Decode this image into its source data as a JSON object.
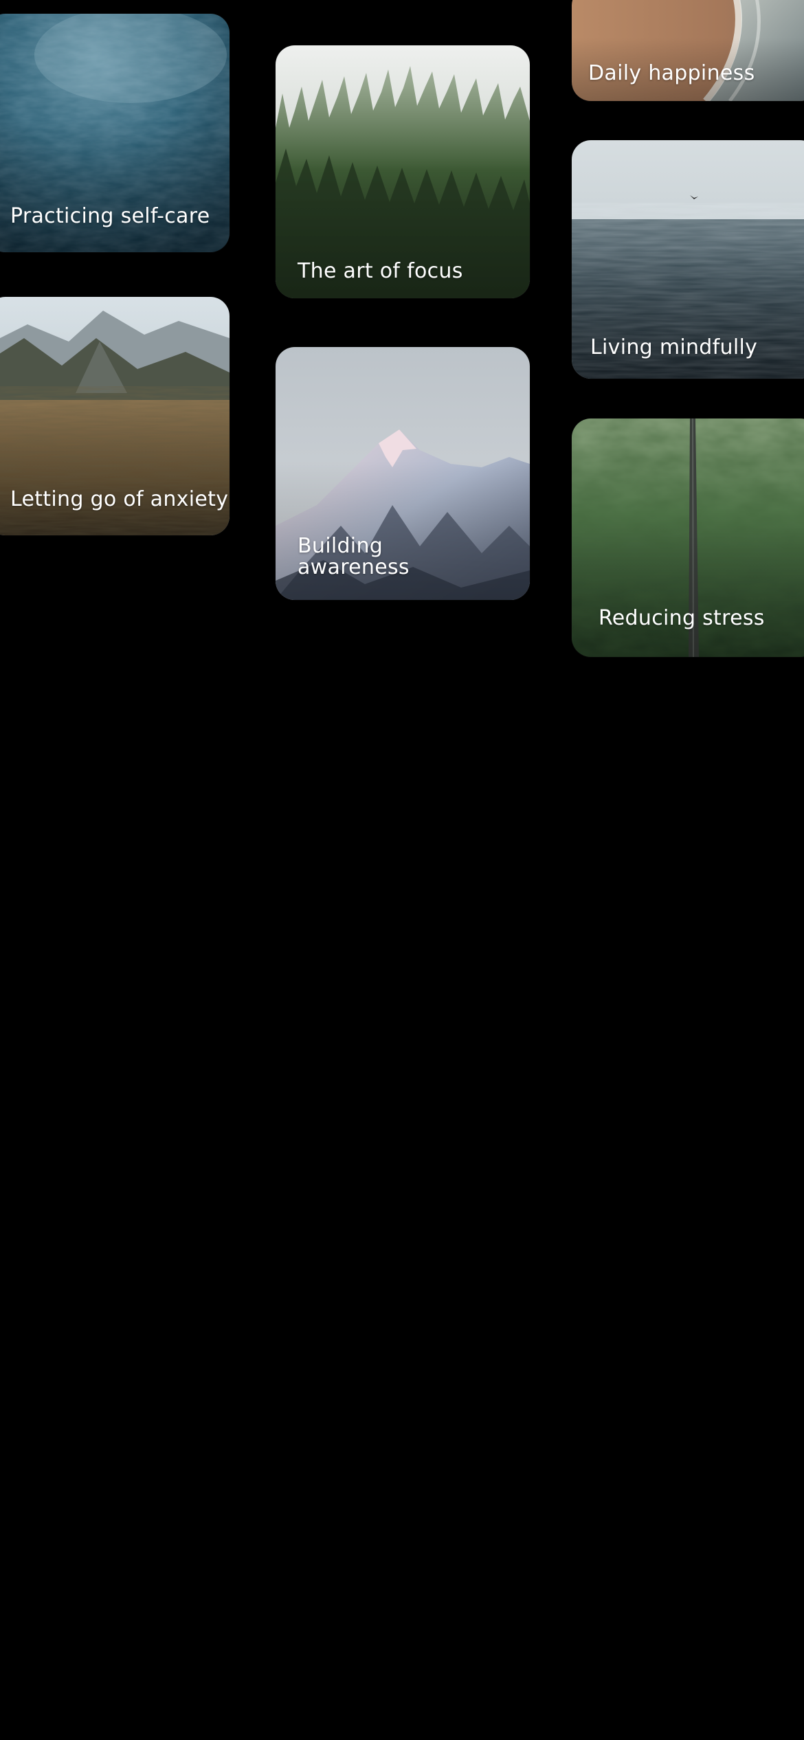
{
  "cards": [
    {
      "id": "selfcare",
      "title": "Practicing self-care",
      "image": "ocean-waves-image"
    },
    {
      "id": "anxiety",
      "title": "Letting go of anxiety",
      "image": "mountain-grassland-image"
    },
    {
      "id": "focus",
      "title": "The art of focus",
      "image": "foggy-forest-image"
    },
    {
      "id": "awareness",
      "title": "Building\nawareness",
      "image": "snowy-peak-image"
    },
    {
      "id": "happiness",
      "title": "Daily happiness",
      "image": "beach-shore-image"
    },
    {
      "id": "mindfully",
      "title": "Living mindfully",
      "image": "sea-with-bird-image"
    },
    {
      "id": "stress",
      "title": "Reducing stress",
      "image": "green-hills-road-image"
    }
  ],
  "theme": {
    "background": "#000000",
    "label_color": "#ffffff"
  }
}
